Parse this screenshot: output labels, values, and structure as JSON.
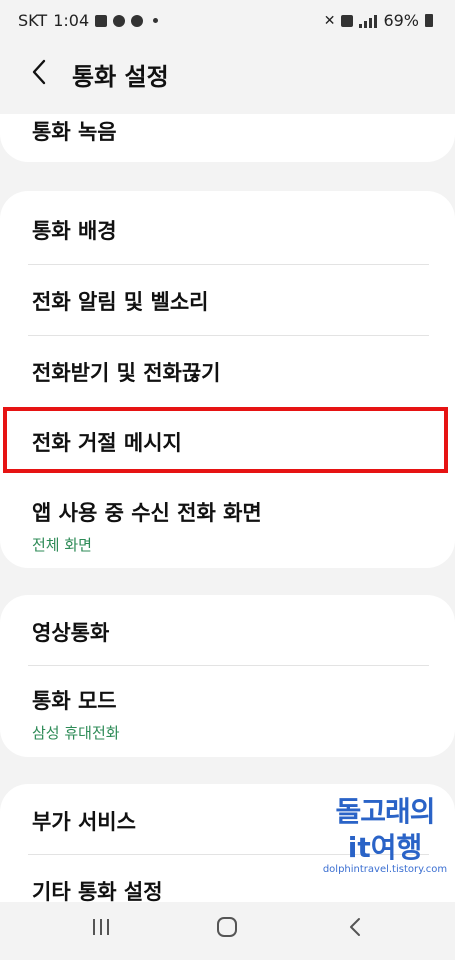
{
  "status": {
    "carrier": "SKT",
    "time": "1:04",
    "battery": "69%"
  },
  "header": {
    "back_icon": "chevron-left-icon",
    "title": "통화 설정"
  },
  "items": {
    "call_recording": "통화 녹음",
    "call_background": "통화 배경",
    "call_alerts": "전화 알림 및 벨소리",
    "answer_end": "전화받기 및 전화끊기",
    "reject_messages": "전화 거절 메시지",
    "incoming_display": {
      "title": "앱 사용 중 수신 전화 화면",
      "sub": "전체 화면"
    },
    "video_call": "영상통화",
    "call_mode": {
      "title": "통화 모드",
      "sub": "삼성 휴대전화"
    },
    "supplementary": "부가 서비스",
    "other_settings": "기타 통화 설정"
  },
  "watermark": {
    "line1": "돌고래의",
    "line2": "it여행",
    "line3": "dolphintravel.tistory.com"
  },
  "colors": {
    "highlight": "#e61313",
    "subtext": "#2e8b57",
    "watermark": "#2a63c7"
  }
}
